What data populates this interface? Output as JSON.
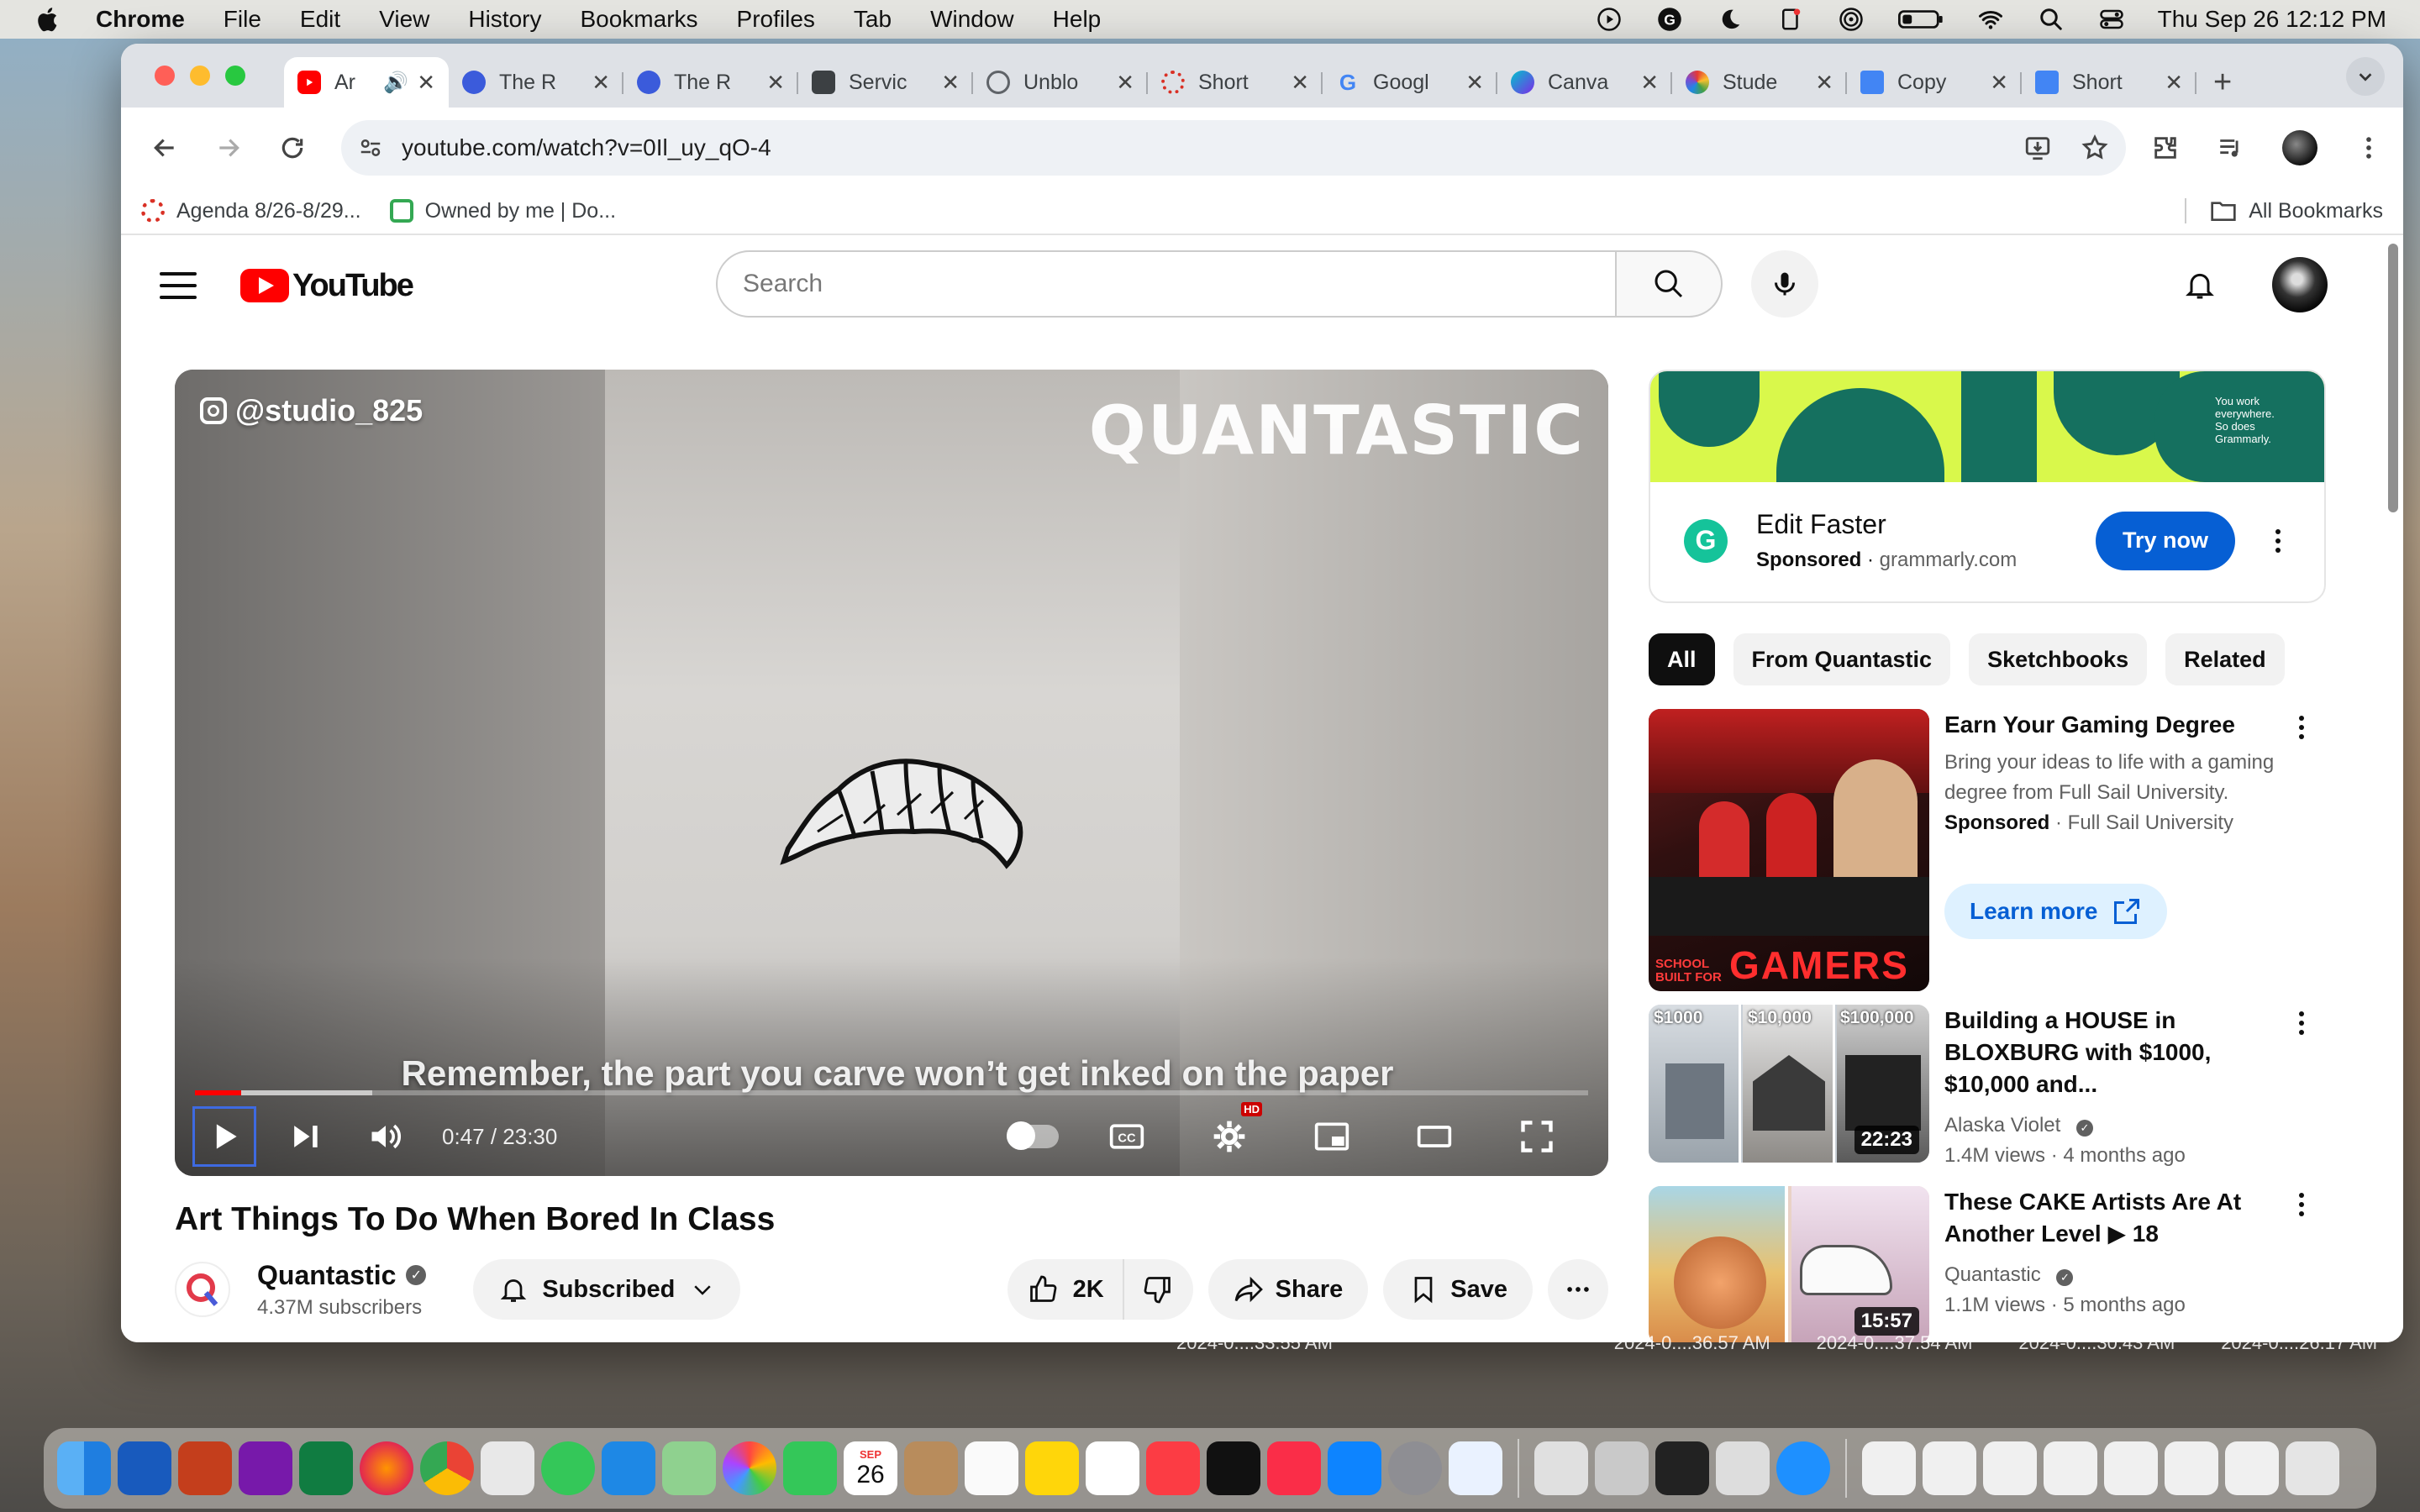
{
  "menubar": {
    "app": "Chrome",
    "items": [
      "File",
      "Edit",
      "View",
      "History",
      "Bookmarks",
      "Profiles",
      "Tab",
      "Window",
      "Help"
    ],
    "clock": "Thu Sep 26  12:12 PM",
    "status_icons": [
      "play-circle-icon",
      "grammarly-icon",
      "moon-icon",
      "notes-icon",
      "airdrop-icon",
      "battery-icon",
      "wifi-icon",
      "search-icon",
      "control-center-icon"
    ]
  },
  "browser": {
    "tabs": [
      {
        "label": "Ar",
        "favicon": "youtube-icon",
        "color": "#ff0000",
        "active": true
      },
      {
        "label": "The R",
        "favicon": "chat-icon",
        "color": "#3b5bdb"
      },
      {
        "label": "The R",
        "favicon": "chat-icon",
        "color": "#3b5bdb"
      },
      {
        "label": "Servic",
        "favicon": "doc-icon",
        "color": "#3c4043"
      },
      {
        "label": "Unblo",
        "favicon": "globe-icon",
        "color": "#5f6368"
      },
      {
        "label": "Short",
        "favicon": "gear-icon",
        "color": "#d93025"
      },
      {
        "label": "Googl",
        "favicon": "google-icon",
        "color": "#4285f4"
      },
      {
        "label": "Canva",
        "favicon": "canva-icon",
        "color": "#00c4cc"
      },
      {
        "label": "Stude",
        "favicon": "student-icon",
        "color": "#7b4bd1"
      },
      {
        "label": "Copy",
        "favicon": "docs-icon",
        "color": "#4285f4"
      },
      {
        "label": "Short",
        "favicon": "docs-icon",
        "color": "#4285f4"
      }
    ],
    "url": "youtube.com/watch?v=0Il_uy_qO-4",
    "bookmarks": [
      {
        "label": "Agenda 8/26-8/29...",
        "icon": "gear-icon",
        "color": "#d93025"
      },
      {
        "label": "Owned by me | Do...",
        "icon": "drive-icon",
        "color": "#34a853"
      }
    ],
    "all_bookmarks": "All Bookmarks"
  },
  "youtube": {
    "logo": "YouTube",
    "search_placeholder": "Search",
    "player": {
      "watermark_handle": "@studio_825",
      "watermark_brand": "QUANTASTIC",
      "caption": "Remember, the part you carve won’t get inked on the paper",
      "time": "0:47 / 23:30",
      "progress_fraction": 0.033,
      "buffered_fraction": 0.127
    },
    "video_title": "Art Things To Do When Bored In Class",
    "channel": {
      "name": "Quantastic",
      "subscribers": "4.37M subscribers",
      "subscribe_label": "Subscribed"
    },
    "actions": {
      "likes": "2K",
      "share": "Share",
      "save": "Save"
    },
    "ad": {
      "banner_text": "You work everywhere. So does Grammarly.",
      "title": "Edit Faster",
      "sponsored": "Sponsored",
      "domain": "grammarly.com",
      "cta": "Try now"
    },
    "chips": [
      "All",
      "From Quantastic",
      "Sketchbooks",
      "Related"
    ],
    "recommendations": [
      {
        "title": "Earn Your Gaming Degree",
        "description": "Bring your ideas to life with a gaming degree from Full Sail University.",
        "sponsored": "Sponsored",
        "advertiser": "Full Sail University",
        "cta": "Learn more",
        "thumb_text": "SCHOOL BUILT FOR GAMERS"
      },
      {
        "title": "Building a HOUSE in BLOXBURG with $1000, $10,000 and...",
        "channel": "Alaska Violet",
        "stats": "1.4M views · 4 months ago",
        "duration": "22:23",
        "thumb_labels": [
          "$1000",
          "$10,000",
          "$100,000"
        ]
      },
      {
        "title": "These CAKE Artists Are At Another Level ▶ 18",
        "channel": "Quantastic",
        "stats": "1.1M views · 5 months ago",
        "duration": "15:57"
      }
    ]
  },
  "desktop": {
    "file_labels": [
      "2024-0....33.55 AM",
      "2024-0....36.57 AM",
      "2024-0....37.54 AM",
      "2024-0....30.43 AM",
      "2024-0....26.17 AM"
    ]
  },
  "dock": {
    "calendar_month": "SEP",
    "calendar_day": "26"
  }
}
